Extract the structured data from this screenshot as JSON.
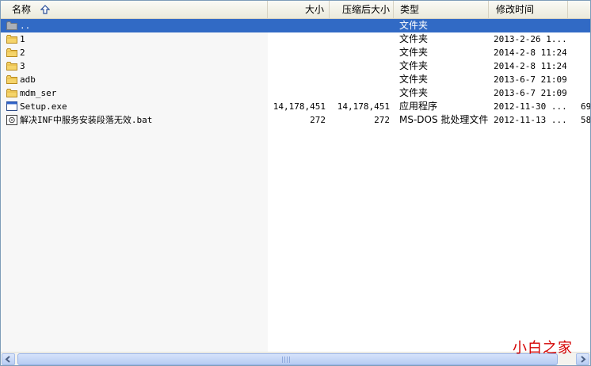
{
  "columns": {
    "name": "名称",
    "size": "大小",
    "compressed": "压缩后大小",
    "type": "类型",
    "modified": "修改时间"
  },
  "rows": [
    {
      "icon": "folder-up-icon",
      "name": "..",
      "size": "",
      "compressed": "",
      "type": "文件夹",
      "modified": "",
      "extra": "",
      "selected": true
    },
    {
      "icon": "folder-icon",
      "name": "1",
      "size": "",
      "compressed": "",
      "type": "文件夹",
      "modified": "2013-2-26 1...",
      "extra": ""
    },
    {
      "icon": "folder-icon",
      "name": "2",
      "size": "",
      "compressed": "",
      "type": "文件夹",
      "modified": "2014-2-8 11:24",
      "extra": ""
    },
    {
      "icon": "folder-icon",
      "name": "3",
      "size": "",
      "compressed": "",
      "type": "文件夹",
      "modified": "2014-2-8 11:24",
      "extra": ""
    },
    {
      "icon": "folder-icon",
      "name": "adb",
      "size": "",
      "compressed": "",
      "type": "文件夹",
      "modified": "2013-6-7 21:09",
      "extra": ""
    },
    {
      "icon": "folder-icon",
      "name": "mdm_ser",
      "size": "",
      "compressed": "",
      "type": "文件夹",
      "modified": "2013-6-7 21:09",
      "extra": ""
    },
    {
      "icon": "exe-icon",
      "name": "Setup.exe",
      "size": "14,178,451",
      "compressed": "14,178,451",
      "type": "应用程序",
      "modified": "2012-11-30 ...",
      "extra": "69"
    },
    {
      "icon": "bat-icon",
      "name": "解决INF中服务安装段落无效.bat",
      "size": "272",
      "compressed": "272",
      "type": "MS-DOS 批处理文件",
      "modified": "2012-11-13 ...",
      "extra": "58"
    }
  ],
  "watermark": "小白之家",
  "colors": {
    "selection": "#316ac5",
    "folder": "#f2c94c",
    "watermark": "#d40000"
  }
}
